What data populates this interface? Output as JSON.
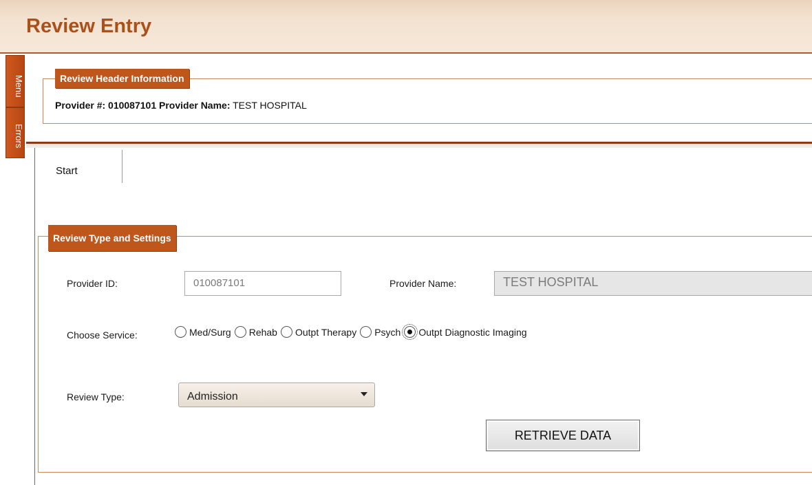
{
  "window": {
    "title": "Review Entry"
  },
  "side_tabs": {
    "menu": "Menu",
    "errors": "Errors"
  },
  "header_section": {
    "legend": "Review Header Information",
    "provider_number_label": "Provider #:",
    "provider_number": "010087101",
    "provider_name_label": "Provider Name:",
    "provider_name": "TEST HOSPITAL"
  },
  "tabs": [
    {
      "label": "Start",
      "selected": true
    }
  ],
  "settings": {
    "legend": "Review Type and Settings",
    "provider_id_label": "Provider ID:",
    "provider_id_value": "010087101",
    "provider_name_label": "Provider Name:",
    "provider_name_value": "TEST HOSPITAL",
    "service_label": "Choose Service:",
    "services": [
      {
        "label": "Med/Surg",
        "checked": false
      },
      {
        "label": "Rehab",
        "checked": false
      },
      {
        "label": "Outpt Therapy",
        "checked": false
      },
      {
        "label": "Psych",
        "checked": false
      },
      {
        "label": "Outpt Diagnostic Imaging",
        "checked": true
      }
    ],
    "review_type_label": "Review Type:",
    "review_type_value": "Admission",
    "retrieve_button": "RETRIEVE DATA"
  },
  "colors": {
    "accent": "#bf561c",
    "title": "#a9501b",
    "border": "#d08758"
  }
}
